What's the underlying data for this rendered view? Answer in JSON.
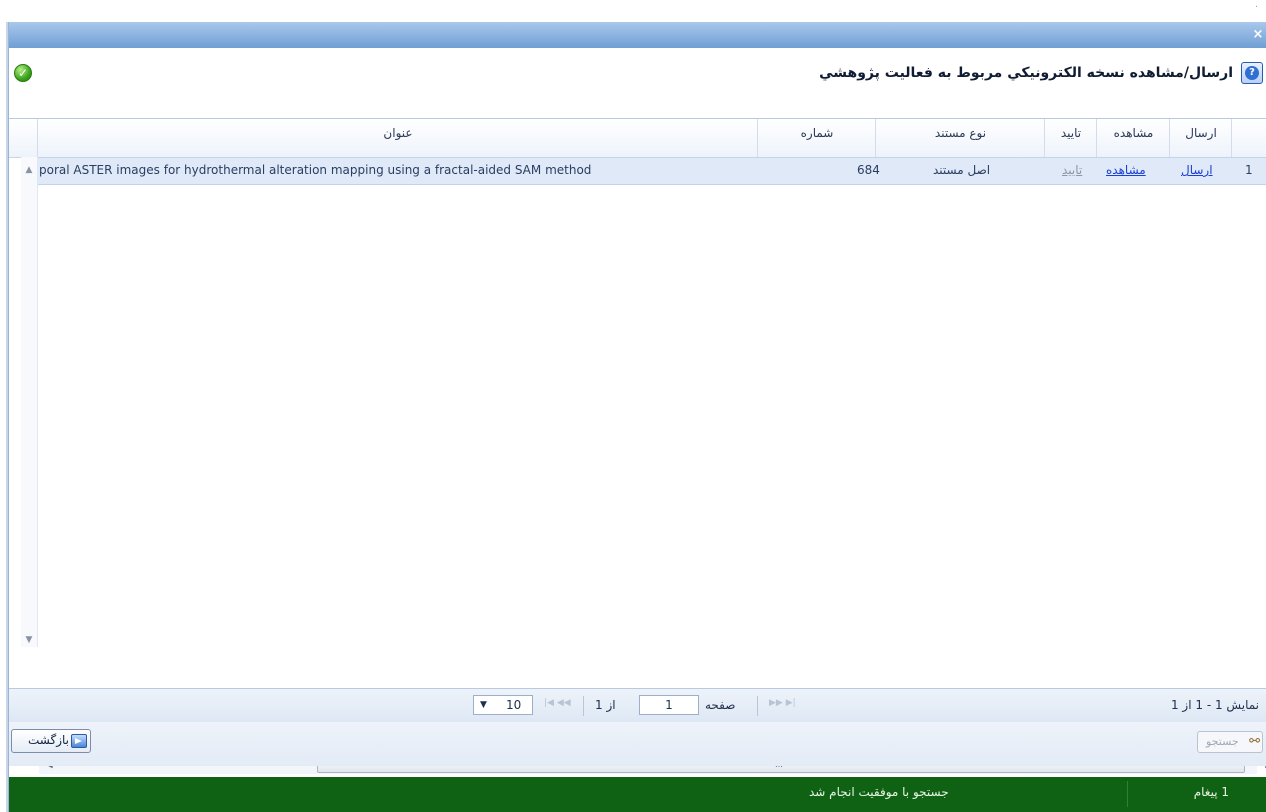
{
  "window": {
    "close_icon": "close-icon"
  },
  "header": {
    "title": "ارسال/مشاهده نسخه الكترونيكي مربوط به فعاليت پژوهشي",
    "help_icon": "help-icon",
    "status_icon": "check-circle-icon"
  },
  "grid": {
    "columns": {
      "send": "ارسال",
      "view": "مشاهده",
      "approve": "تاييد",
      "doc_type": "نوع مستند",
      "number": "شماره",
      "title": "عنوان"
    },
    "rows": [
      {
        "index": "1",
        "send": "ارسال",
        "view": "مشاهده",
        "approve": "تاييد",
        "doc_type": "اصل مستند",
        "number": "684",
        "title": "poral ASTER images for hydrothermal alteration mapping using a fractal-aided SAM method"
      }
    ],
    "scroll_grip": "III"
  },
  "pager": {
    "page_label": "صفحه",
    "page_value": "1",
    "of_label": "از 1",
    "page_size": "10",
    "summary": "نمایش 1 - 1 از 1"
  },
  "toolbar": {
    "back_label": "بازگشت",
    "search_label": "جستجو"
  },
  "status": {
    "message": "جستجو با موفقیت انجام شد",
    "count": "1 پیغام",
    "color": "#0f6214"
  }
}
